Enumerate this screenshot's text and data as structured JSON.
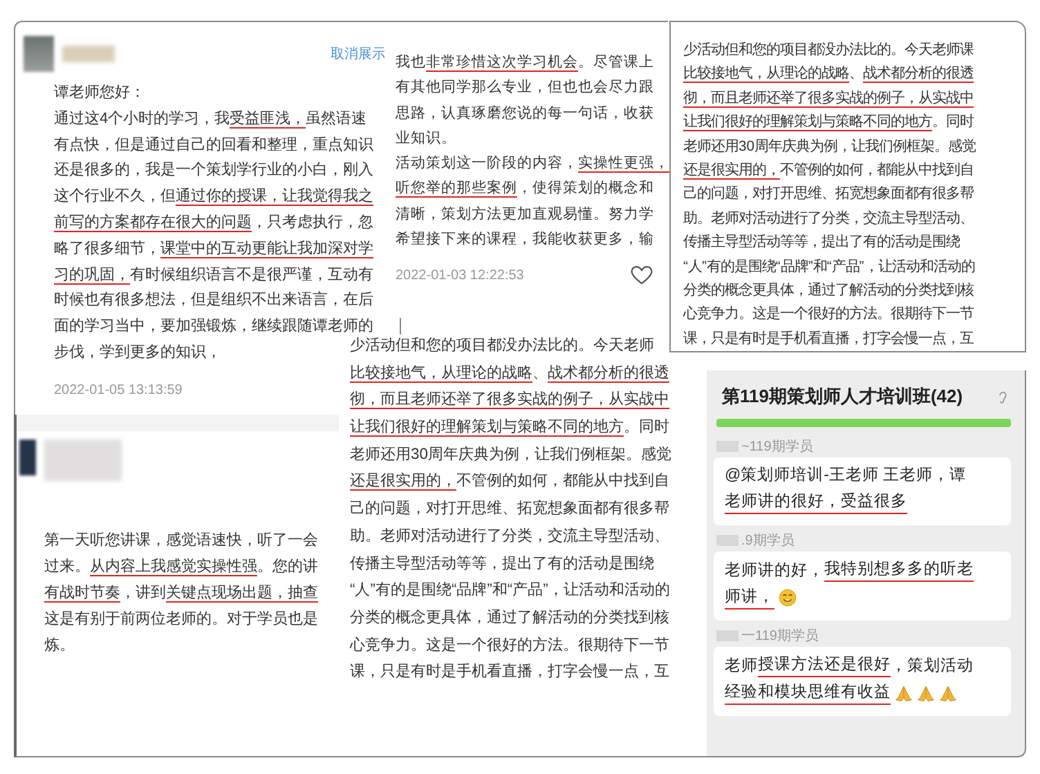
{
  "cards": [
    {
      "kind": "review",
      "link": "取消展示",
      "date": "2022-01-05 13:13:59",
      "lines": [
        [
          {
            "text": "谭老师您好：",
            "underlined": false
          }
        ],
        [
          {
            "text": "通过这4个小时的学习，我",
            "underlined": false
          },
          {
            "text": "受益匪浅，",
            "underlined": true
          },
          {
            "text": "虽然语速",
            "underlined": false
          }
        ],
        [
          {
            "text": "有点快，但是通过自己的回看和整理，重点知识",
            "underlined": false
          }
        ],
        [
          {
            "text": "还是很多的，我是一个策划学行业的小白，刚入",
            "underlined": false
          }
        ],
        [
          {
            "text": "这个行业不久，但",
            "underlined": false
          },
          {
            "text": "通过你的授课，让我觉得我之",
            "underlined": true
          }
        ],
        [
          {
            "text": "前写的方案都存在很大的问题",
            "underlined": true
          },
          {
            "text": "，只考虑执行，忽",
            "underlined": false
          }
        ],
        [
          {
            "text": "略了很多细节，",
            "underlined": false
          },
          {
            "text": "课堂中的互动更能让我加深对学",
            "underlined": true
          }
        ],
        [
          {
            "text": "习的巩固，",
            "underlined": true
          },
          {
            "text": "有时候组织语言不是很严谨，互动有",
            "underlined": false
          }
        ],
        [
          {
            "text": "时候也有很多想法，但是组织不出来语言，在后",
            "underlined": false
          }
        ],
        [
          {
            "text": "面的学习当中，要加强锻炼，继续跟随谭老师的",
            "underlined": false
          }
        ],
        [
          {
            "text": "步伐，学到更多的知识，",
            "underlined": false
          }
        ]
      ]
    },
    {
      "kind": "continuation",
      "date": "2022-01-03 12:22:53",
      "lines": [
        [
          {
            "text": "我也",
            "underlined": false
          },
          {
            "text": "非常珍惜这次学习机会",
            "underlined": true
          },
          {
            "text": "。尽管课上",
            "underlined": false
          }
        ],
        [
          {
            "text": "有其他同学那么专业，但也也会尽力跟",
            "underlined": false
          }
        ],
        [
          {
            "text": "思路，认真琢磨您说的每一句话，收获",
            "underlined": false
          }
        ],
        [
          {
            "text": "业知识。",
            "underlined": false
          }
        ],
        [
          {
            "text": "活动策划这一阶段的内容，",
            "underlined": false
          },
          {
            "text": "实操性更强，",
            "underlined": true
          }
        ],
        [
          {
            "text": "听您举的那些案例",
            "underlined": true
          },
          {
            "text": "，使得策划的概念和",
            "underlined": false
          }
        ],
        [
          {
            "text": "清晰，策划方法更加直观易懂。努力学",
            "underlined": false
          }
        ],
        [
          {
            "text": "希望接下来的课程，我能收获更多，输",
            "underlined": false
          }
        ]
      ]
    },
    {
      "kind": "excerpt",
      "lines": [
        [
          {
            "text": "少活动但和您的项目都没办法比的。今天老师课",
            "underlined": false
          }
        ],
        [
          {
            "text": "比较接地气，从理论的战略",
            "underlined": true
          },
          {
            "text": "、",
            "underlined": false
          },
          {
            "text": "战术都分析的很透",
            "underlined": true
          }
        ],
        [
          {
            "text": "彻，而且老师还举了很多实战的例子，从实战中",
            "underlined": true
          }
        ],
        [
          {
            "text": "让我们很好的理解策划与策略不同的地方",
            "underlined": true
          },
          {
            "text": "。同时",
            "underlined": false
          }
        ],
        [
          {
            "text": "老师还用30周年庆典为例，让我们例框架。感觉",
            "underlined": false
          }
        ],
        [
          {
            "text": "还是很实用的，",
            "underlined": true
          },
          {
            "text": "不管例的如何，都能从中找到自",
            "underlined": false
          }
        ],
        [
          {
            "text": "己的问题，对打开思维、拓宽想象面都有很多帮",
            "underlined": false
          }
        ],
        [
          {
            "text": "助。老师对活动进行了分类，交流主导型活动、",
            "underlined": false
          }
        ],
        [
          {
            "text": "传播主导型活动等等，提出了有的活动是围绕",
            "underlined": false
          }
        ],
        [
          {
            "text": "“人”有的是围绕“品牌”和“产品”，让活动和活动的",
            "underlined": false
          }
        ],
        [
          {
            "text": "分类的概念更具体，通过了解活动的分类找到核",
            "underlined": false
          }
        ],
        [
          {
            "text": "心竞争力。这是一个很好的方法。很期待下一节",
            "underlined": false
          }
        ],
        [
          {
            "text": "课，只是有时是手机看直播，打字会慢一点，互",
            "underlined": false
          }
        ]
      ]
    },
    {
      "kind": "review",
      "lines": [
        [
          {
            "text": "第一天听您讲课，感觉语速快，听了一会",
            "underlined": false
          }
        ],
        [
          {
            "text": "过来。",
            "underlined": false
          },
          {
            "text": "从内容上我感觉实操性强",
            "underlined": true
          },
          {
            "text": "。您的讲",
            "underlined": false
          }
        ],
        [
          {
            "text": "有战时节奏",
            "underlined": true
          },
          {
            "text": "，讲到",
            "underlined": false
          },
          {
            "text": "关键点现场出题，",
            "underlined": true
          },
          {
            "text": "抽查",
            "underlined": true
          }
        ],
        [
          {
            "text": "这是有别于前两位老师的。对于学员也是",
            "underlined": false
          }
        ],
        [
          {
            "text": "炼。",
            "underlined": false
          }
        ]
      ]
    },
    {
      "kind": "excerpt",
      "lines": [
        [
          {
            "text": "少活动但和您的项目都没办法比的。今天老师",
            "underlined": false
          }
        ],
        [
          {
            "text": "比较接地气，从理论的战略",
            "underlined": true
          },
          {
            "text": "、",
            "underlined": false
          },
          {
            "text": "战术都分析的很透",
            "underlined": true
          }
        ],
        [
          {
            "text": "彻，而且老师还举了很多实战的例子，从实战中",
            "underlined": true
          }
        ],
        [
          {
            "text": "让我们很好的理解策划与策略不同的地方",
            "underlined": true
          },
          {
            "text": "。同时",
            "underlined": false
          }
        ],
        [
          {
            "text": "老师还用30周年庆典为例，让我们例框架。感觉",
            "underlined": false
          }
        ],
        [
          {
            "text": "还是很实用的，",
            "underlined": true
          },
          {
            "text": "不管例的如何，都能从中找到自",
            "underlined": false
          }
        ],
        [
          {
            "text": "己的问题，对打开思维、拓宽想象面都有很多帮",
            "underlined": false
          }
        ],
        [
          {
            "text": "助。老师对活动进行了分类，交流主导型活动、",
            "underlined": false
          }
        ],
        [
          {
            "text": "传播主导型活动等等，提出了有的活动是围绕",
            "underlined": false
          }
        ],
        [
          {
            "text": "“人”有的是围绕“品牌”和“产品”，让活动和活动的",
            "underlined": false
          }
        ],
        [
          {
            "text": "分类的概念更具体，通过了解活动的分类找到核",
            "underlined": false
          }
        ],
        [
          {
            "text": "心竞争力。这是一个很好的方法。很期待下一节",
            "underlined": false
          }
        ],
        [
          {
            "text": "课，只是有时是手机看直播，打字会慢一点，互",
            "underlined": false
          }
        ]
      ]
    },
    {
      "kind": "chat",
      "title": "第119期策划师人才培训班(42)",
      "messages": [
        {
          "sender": "~119期学员",
          "lines": [
            [
              {
                "text": "@策划师培训-王老师  王老师，谭",
                "underlined": false
              }
            ],
            [
              {
                "text": "老师讲的很好，受益很多",
                "underlined": true
              }
            ]
          ]
        },
        {
          "sender": ".9期学员",
          "emojis": [
            {
              "kind": "smiley"
            }
          ],
          "lines": [
            [
              {
                "text": "老师讲的好，",
                "underlined": false
              },
              {
                "text": "我特别想多多的听老",
                "underlined": true
              }
            ],
            [
              {
                "text": "师讲，",
                "underlined": true
              }
            ]
          ]
        },
        {
          "sender": "一119期学员",
          "emojis": [
            {
              "kind": "praying-hands"
            },
            {
              "kind": "praying-hands"
            },
            {
              "kind": "praying-hands"
            }
          ],
          "lines": [
            [
              {
                "text": "老师",
                "underlined": false
              },
              {
                "text": "授课方法还是很好",
                "underlined": true
              },
              {
                "text": "，策划活动",
                "underlined": false
              }
            ],
            [
              {
                "text": "经验和模块思维有收益",
                "underlined": true
              }
            ]
          ]
        }
      ]
    }
  ]
}
